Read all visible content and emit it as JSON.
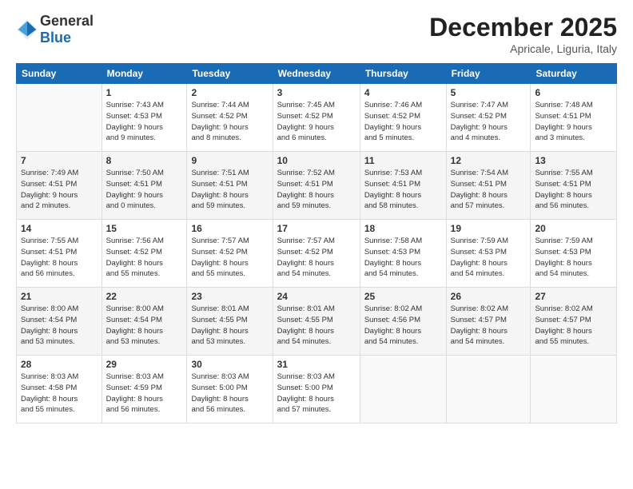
{
  "header": {
    "logo_general": "General",
    "logo_blue": "Blue",
    "month": "December 2025",
    "location": "Apricale, Liguria, Italy"
  },
  "days_of_week": [
    "Sunday",
    "Monday",
    "Tuesday",
    "Wednesday",
    "Thursday",
    "Friday",
    "Saturday"
  ],
  "weeks": [
    [
      {
        "day": "",
        "info": ""
      },
      {
        "day": "1",
        "info": "Sunrise: 7:43 AM\nSunset: 4:53 PM\nDaylight: 9 hours\nand 9 minutes."
      },
      {
        "day": "2",
        "info": "Sunrise: 7:44 AM\nSunset: 4:52 PM\nDaylight: 9 hours\nand 8 minutes."
      },
      {
        "day": "3",
        "info": "Sunrise: 7:45 AM\nSunset: 4:52 PM\nDaylight: 9 hours\nand 6 minutes."
      },
      {
        "day": "4",
        "info": "Sunrise: 7:46 AM\nSunset: 4:52 PM\nDaylight: 9 hours\nand 5 minutes."
      },
      {
        "day": "5",
        "info": "Sunrise: 7:47 AM\nSunset: 4:52 PM\nDaylight: 9 hours\nand 4 minutes."
      },
      {
        "day": "6",
        "info": "Sunrise: 7:48 AM\nSunset: 4:51 PM\nDaylight: 9 hours\nand 3 minutes."
      }
    ],
    [
      {
        "day": "7",
        "info": "Sunrise: 7:49 AM\nSunset: 4:51 PM\nDaylight: 9 hours\nand 2 minutes."
      },
      {
        "day": "8",
        "info": "Sunrise: 7:50 AM\nSunset: 4:51 PM\nDaylight: 9 hours\nand 0 minutes."
      },
      {
        "day": "9",
        "info": "Sunrise: 7:51 AM\nSunset: 4:51 PM\nDaylight: 8 hours\nand 59 minutes."
      },
      {
        "day": "10",
        "info": "Sunrise: 7:52 AM\nSunset: 4:51 PM\nDaylight: 8 hours\nand 59 minutes."
      },
      {
        "day": "11",
        "info": "Sunrise: 7:53 AM\nSunset: 4:51 PM\nDaylight: 8 hours\nand 58 minutes."
      },
      {
        "day": "12",
        "info": "Sunrise: 7:54 AM\nSunset: 4:51 PM\nDaylight: 8 hours\nand 57 minutes."
      },
      {
        "day": "13",
        "info": "Sunrise: 7:55 AM\nSunset: 4:51 PM\nDaylight: 8 hours\nand 56 minutes."
      }
    ],
    [
      {
        "day": "14",
        "info": "Sunrise: 7:55 AM\nSunset: 4:51 PM\nDaylight: 8 hours\nand 56 minutes."
      },
      {
        "day": "15",
        "info": "Sunrise: 7:56 AM\nSunset: 4:52 PM\nDaylight: 8 hours\nand 55 minutes."
      },
      {
        "day": "16",
        "info": "Sunrise: 7:57 AM\nSunset: 4:52 PM\nDaylight: 8 hours\nand 55 minutes."
      },
      {
        "day": "17",
        "info": "Sunrise: 7:57 AM\nSunset: 4:52 PM\nDaylight: 8 hours\nand 54 minutes."
      },
      {
        "day": "18",
        "info": "Sunrise: 7:58 AM\nSunset: 4:53 PM\nDaylight: 8 hours\nand 54 minutes."
      },
      {
        "day": "19",
        "info": "Sunrise: 7:59 AM\nSunset: 4:53 PM\nDaylight: 8 hours\nand 54 minutes."
      },
      {
        "day": "20",
        "info": "Sunrise: 7:59 AM\nSunset: 4:53 PM\nDaylight: 8 hours\nand 54 minutes."
      }
    ],
    [
      {
        "day": "21",
        "info": "Sunrise: 8:00 AM\nSunset: 4:54 PM\nDaylight: 8 hours\nand 53 minutes."
      },
      {
        "day": "22",
        "info": "Sunrise: 8:00 AM\nSunset: 4:54 PM\nDaylight: 8 hours\nand 53 minutes."
      },
      {
        "day": "23",
        "info": "Sunrise: 8:01 AM\nSunset: 4:55 PM\nDaylight: 8 hours\nand 53 minutes."
      },
      {
        "day": "24",
        "info": "Sunrise: 8:01 AM\nSunset: 4:55 PM\nDaylight: 8 hours\nand 54 minutes."
      },
      {
        "day": "25",
        "info": "Sunrise: 8:02 AM\nSunset: 4:56 PM\nDaylight: 8 hours\nand 54 minutes."
      },
      {
        "day": "26",
        "info": "Sunrise: 8:02 AM\nSunset: 4:57 PM\nDaylight: 8 hours\nand 54 minutes."
      },
      {
        "day": "27",
        "info": "Sunrise: 8:02 AM\nSunset: 4:57 PM\nDaylight: 8 hours\nand 55 minutes."
      }
    ],
    [
      {
        "day": "28",
        "info": "Sunrise: 8:03 AM\nSunset: 4:58 PM\nDaylight: 8 hours\nand 55 minutes."
      },
      {
        "day": "29",
        "info": "Sunrise: 8:03 AM\nSunset: 4:59 PM\nDaylight: 8 hours\nand 56 minutes."
      },
      {
        "day": "30",
        "info": "Sunrise: 8:03 AM\nSunset: 5:00 PM\nDaylight: 8 hours\nand 56 minutes."
      },
      {
        "day": "31",
        "info": "Sunrise: 8:03 AM\nSunset: 5:00 PM\nDaylight: 8 hours\nand 57 minutes."
      },
      {
        "day": "",
        "info": ""
      },
      {
        "day": "",
        "info": ""
      },
      {
        "day": "",
        "info": ""
      }
    ]
  ]
}
